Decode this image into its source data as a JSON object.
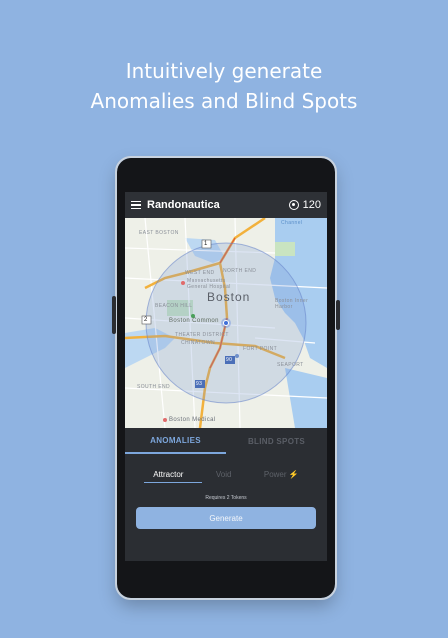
{
  "headline": {
    "line1": "Intuitively generate",
    "line2": "Anomalies and Blind Spots"
  },
  "app": {
    "title": "Randonautica",
    "tokens": "120",
    "icons": {
      "menu": "hamburger-menu-icon",
      "token": "token-coin-icon"
    }
  },
  "map": {
    "city": "Boston",
    "labels": {
      "east_boston": "EAST BOSTON",
      "north_end": "NORTH END",
      "west_end": "WEST END",
      "beacon_hill": "BEACON HILL",
      "mass_general": "Massachusetts General Hospital",
      "boston_common": "Boston Common",
      "theater_district": "THEATER DISTRICT",
      "chinatown": "CHINATOWN",
      "fort_point": "FORT POINT",
      "seaport": "SEAPORT",
      "boston_inner_harbor": "Boston Inner Harbor",
      "south_end": "SOUTH END",
      "boston_medical": "Boston Medical",
      "channel": "Channel",
      "highway_1": "1",
      "highway_2": "2",
      "highway_90": "90",
      "highway_93": "93"
    }
  },
  "tabs": [
    {
      "label": "ANOMALIES",
      "active": true
    },
    {
      "label": "BLIND SPOTS",
      "active": false
    }
  ],
  "options": {
    "attractor": "Attractor",
    "void": "Void",
    "power": "Power",
    "power_icon": "lightning-bolt-icon"
  },
  "requires_text": "Requires 2 Tokens",
  "generate_label": "Generate",
  "colors": {
    "background": "#8fb3e1",
    "accent": "#7da7dd",
    "panel": "#2b2e33",
    "highway": "#f2b13c"
  }
}
